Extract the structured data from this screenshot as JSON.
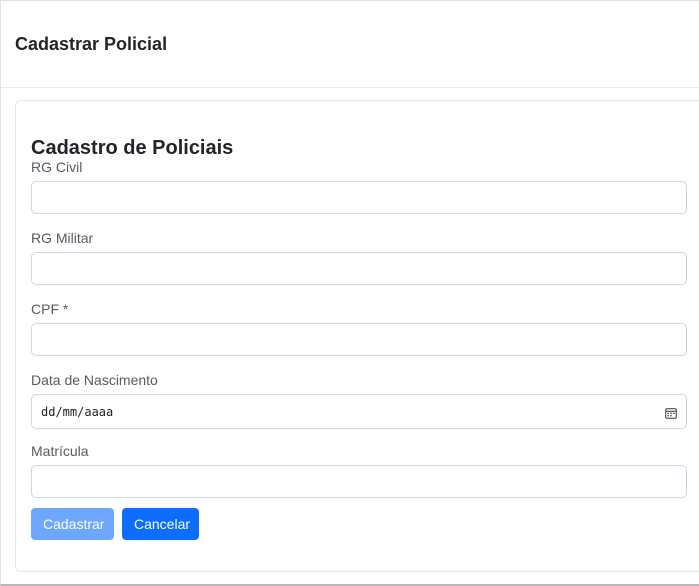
{
  "header": {
    "title": "Cadastrar Policial"
  },
  "form": {
    "title": "Cadastro de Policiais",
    "fields": [
      {
        "label": "RG Civil",
        "value": ""
      },
      {
        "label": "RG Militar",
        "value": ""
      },
      {
        "label": "CPF *",
        "value": ""
      },
      {
        "label": "Data de Nascimento",
        "value": "dd/mm/aaaa"
      },
      {
        "label": "Matrícula",
        "value": ""
      }
    ],
    "date_icon": "calendar-icon",
    "buttons": {
      "submit_label": "Cadastrar",
      "submit_state": "disabled",
      "cancel_label": "Cancelar"
    }
  },
  "colors": {
    "primary": "#0d6efd",
    "primary_disabled": "#6ea8fe",
    "input_border": "#cfd4e6"
  }
}
